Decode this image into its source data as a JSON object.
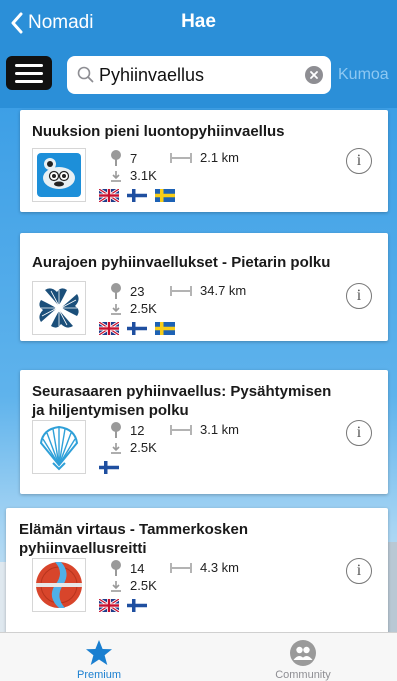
{
  "nav": {
    "back_label": "Nomadi",
    "title": "Hae"
  },
  "search": {
    "query": "Pyhiinvaellus",
    "placeholder": "",
    "cancel_label": "Kumoa"
  },
  "routes": [
    {
      "title": "Nuuksion pieni luontopyhiinvaellus",
      "stops": "7",
      "distance": "2.1 km",
      "downloads": "3.1K",
      "thumbnail_icon": "mascot-icon",
      "languages": [
        "en",
        "fi",
        "sv"
      ]
    },
    {
      "title": "Aurajoen pyhiinvaellukset - Pietarin polku",
      "stops": "23",
      "distance": "34.7 km",
      "downloads": "2.5K",
      "thumbnail_icon": "crossed-shells-icon",
      "languages": [
        "en",
        "fi",
        "sv"
      ]
    },
    {
      "title": "Seurasaaren pyhiinvaellus: Pysähtymisen ja hiljentymisen polku",
      "stops": "12",
      "distance": "3.1 km",
      "downloads": "2.5K",
      "thumbnail_icon": "scallop-shell-icon",
      "languages": [
        "fi"
      ]
    },
    {
      "title": "Elämän virtaus - Tammerkosken pyhiinvaellusreitti",
      "stops": "14",
      "distance": "4.3 km",
      "downloads": "2.5K",
      "thumbnail_icon": "river-emblem-icon",
      "languages": [
        "en",
        "fi"
      ]
    }
  ],
  "tabs": [
    {
      "label": "Premium",
      "icon": "star-icon",
      "active": true
    },
    {
      "label": "Community",
      "icon": "community-icon",
      "active": false
    }
  ],
  "colors": {
    "brand": "#2b8fd8",
    "active_tab": "#1a7fd0",
    "inactive_tab": "#8e8e93"
  }
}
